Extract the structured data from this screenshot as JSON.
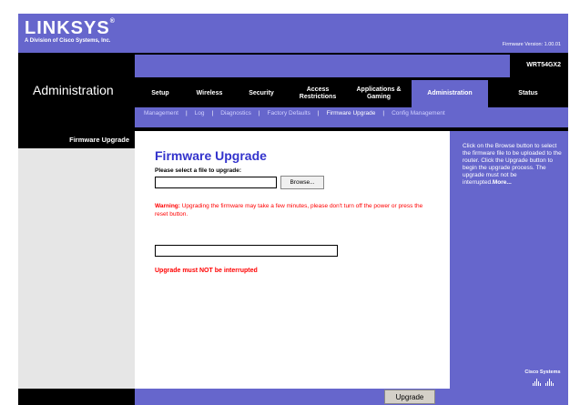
{
  "brand": {
    "logo": "LINKSYS",
    "logo_mark": "®",
    "subtitle": "A Division of Cisco Systems, Inc."
  },
  "firmware_version": "Firmware Version: 1.00.01",
  "model": "WRT54GX2",
  "page_section": "Administration",
  "tabs": [
    {
      "label": "Setup",
      "active": false
    },
    {
      "label": "Wireless",
      "active": false
    },
    {
      "label": "Security",
      "active": false
    },
    {
      "label": "Access Restrictions",
      "active": false
    },
    {
      "label": "Applications & Gaming",
      "active": false
    },
    {
      "label": "Administration",
      "active": true
    },
    {
      "label": "Status",
      "active": false
    }
  ],
  "subtabs": [
    {
      "label": "Management",
      "active": false
    },
    {
      "label": "Log",
      "active": false
    },
    {
      "label": "Diagnostics",
      "active": false
    },
    {
      "label": "Factory Defaults",
      "active": false
    },
    {
      "label": "Firmware Upgrade",
      "active": true
    },
    {
      "label": "Config Management",
      "active": false
    }
  ],
  "left_header": "Firmware Upgrade",
  "main": {
    "title": "Firmware Upgrade",
    "select_label": "Please select a file to upgrade:",
    "file_value": "",
    "browse_label": "Browse...",
    "warning_label": "Warning:",
    "warning_text": " Upgrading the firmware may take a few minutes, please don't turn off the power or press the reset button.",
    "progress": 0,
    "interrupt_note": "Upgrade must NOT be interrupted"
  },
  "help": {
    "text": "Click on the Browse button to select the firmware file to be uploaded to the router. Click the Upgrade button to begin the upgrade process. The upgrade must not be interrupted.",
    "more": "More..."
  },
  "cisco_label": "Cisco Systems",
  "footer": {
    "upgrade_label": "Upgrade"
  },
  "colors": {
    "accent": "#6666cc",
    "title_blue": "#3333cc",
    "warning_red": "#ff0000",
    "black": "#000000"
  }
}
